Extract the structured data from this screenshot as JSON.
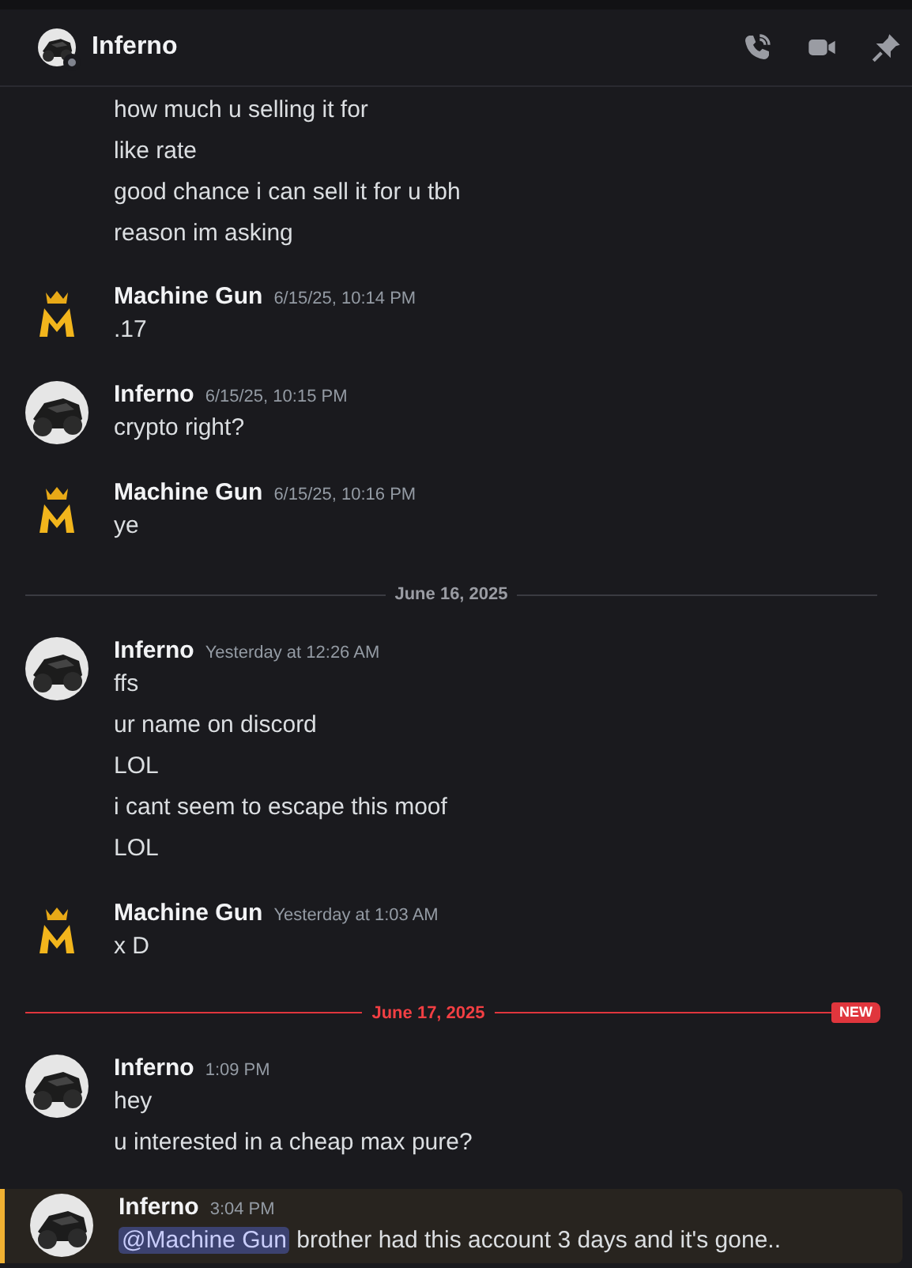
{
  "header": {
    "title": "Inferno",
    "avatar": {
      "kind": "bike"
    }
  },
  "messages": [
    {
      "kind": "continuation",
      "lines": [
        {
          "text": "how much u selling it for"
        },
        {
          "text": "like rate"
        },
        {
          "text": "good chance i can sell it for u tbh"
        },
        {
          "text": "reason im asking"
        }
      ]
    },
    {
      "kind": "group",
      "avatar": {
        "kind": "crown"
      },
      "author": "Machine Gun",
      "time": "6/15/25, 10:14 PM",
      "highlighted": false,
      "lines": [
        {
          "text": ".17"
        }
      ]
    },
    {
      "kind": "group",
      "avatar": {
        "kind": "bike"
      },
      "author": "Inferno",
      "time": "6/15/25, 10:15 PM",
      "highlighted": false,
      "lines": [
        {
          "text": "crypto right?"
        }
      ]
    },
    {
      "kind": "group",
      "avatar": {
        "kind": "crown"
      },
      "author": "Machine Gun",
      "time": "6/15/25, 10:16 PM",
      "highlighted": false,
      "lines": [
        {
          "text": "ye"
        }
      ]
    },
    {
      "kind": "divider",
      "label": "June 16, 2025"
    },
    {
      "kind": "group",
      "avatar": {
        "kind": "bike"
      },
      "author": "Inferno",
      "time": "Yesterday at 12:26 AM",
      "highlighted": false,
      "lines": [
        {
          "text": "ffs"
        },
        {
          "text": "ur name on discord"
        },
        {
          "text": "LOL"
        },
        {
          "text": "i cant seem to escape this moof"
        },
        {
          "text": "LOL"
        }
      ]
    },
    {
      "kind": "group",
      "avatar": {
        "kind": "crown"
      },
      "author": "Machine Gun",
      "time": "Yesterday at 1:03 AM",
      "highlighted": false,
      "lines": [
        {
          "text": "x D"
        }
      ]
    },
    {
      "kind": "divider",
      "label": "June 17, 2025",
      "badge": "NEW"
    },
    {
      "kind": "group",
      "avatar": {
        "kind": "bike"
      },
      "author": "Inferno",
      "time": "1:09 PM",
      "highlighted": false,
      "lines": [
        {
          "text": "hey"
        },
        {
          "text": "u interested in a cheap max pure?"
        }
      ]
    },
    {
      "kind": "group",
      "avatar": {
        "kind": "bike"
      },
      "author": "Inferno",
      "time": "3:04 PM",
      "highlighted": true,
      "lines": [
        {
          "mention": "@Machine Gun",
          "text": " brother had this account 3 days and it's gone.."
        }
      ]
    }
  ]
}
